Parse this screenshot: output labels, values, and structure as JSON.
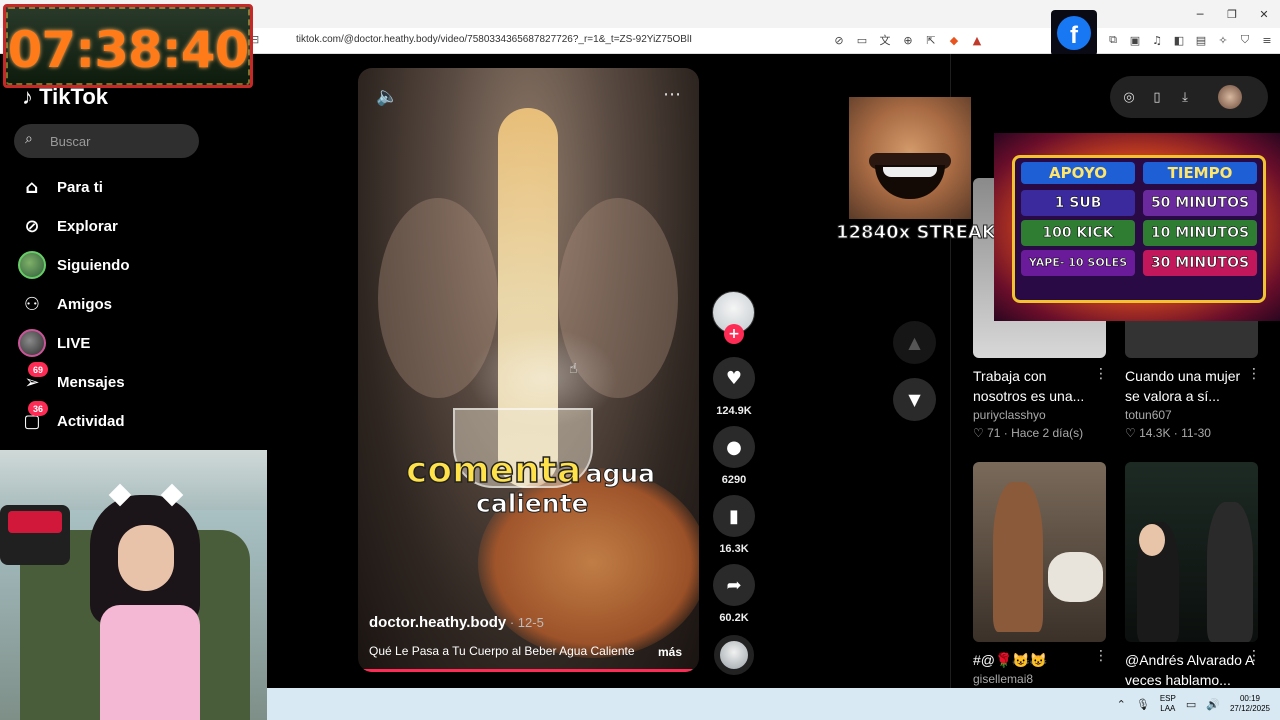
{
  "browser": {
    "url": "tiktok.com/@doctor.heathy.body/video/7580334365687827726?_r=1&_t=ZS-92YiZ75OBlI",
    "window_controls": [
      "minimize-icon",
      "restore-icon",
      "close-icon"
    ]
  },
  "timer_overlay": {
    "time": "07:38:40"
  },
  "sidebar": {
    "logo": "TikTok",
    "search_placeholder": "Buscar",
    "items": [
      {
        "label": "Para ti",
        "icon": "home-icon"
      },
      {
        "label": "Explorar",
        "icon": "compass-icon"
      },
      {
        "label": "Siguiendo",
        "icon": "following-avatar-icon"
      },
      {
        "label": "Amigos",
        "icon": "friends-icon"
      },
      {
        "label": "LIVE",
        "icon": "live-avatar-icon"
      },
      {
        "label": "Mensajes",
        "icon": "send-icon",
        "badge": "69"
      },
      {
        "label": "Actividad",
        "icon": "inbox-icon",
        "badge": "36"
      }
    ]
  },
  "video": {
    "overlay_highlight": "comenta",
    "overlay_rest": "agua",
    "overlay_line2": "caliente",
    "author": "doctor.heathy.body",
    "date": "12-5",
    "description": "Qué Le Pasa a Tu Cuerpo al Beber Agua Caliente",
    "more_label": "más",
    "progress_fraction": 0.98
  },
  "actions": {
    "likes": "124.9K",
    "comments": "6290",
    "saves": "16.3K",
    "shares": "60.2K"
  },
  "right_cards": [
    {
      "title": "Trabaja con nosotros es una...",
      "user": "puriyclasshyo",
      "likes": "71",
      "age": "Hace 2 día(s)"
    },
    {
      "title": "Cuando una mujer se valora a sí...",
      "user": "totun607",
      "likes": "14.3K",
      "age": "11-30"
    },
    {
      "title": "#@🌹😺😺",
      "user": "gisellemai8"
    },
    {
      "title": "@Andrés Alvarado A veces hablamo...",
      "user": ""
    }
  ],
  "stream_overlay": {
    "streak": "12840x STREAK",
    "promo": {
      "headers": [
        "APOYO",
        "TIEMPO"
      ],
      "rows": [
        {
          "left": "1 SUB",
          "right": "50 MINUTOS"
        },
        {
          "left": "100 KICK",
          "right": "10 MINUTOS"
        },
        {
          "left": "YAPE- 10 SOLES",
          "right": "30 MINUTOS"
        }
      ]
    }
  },
  "taskbar": {
    "lang_top": "ESP",
    "lang_bottom": "LAA",
    "time": "00:19",
    "date": "27/12/2025"
  },
  "colors": {
    "accent": "#fe2c55",
    "background": "#000000",
    "facebook": "#1877f2",
    "timer_digits": "#ff7a18"
  }
}
